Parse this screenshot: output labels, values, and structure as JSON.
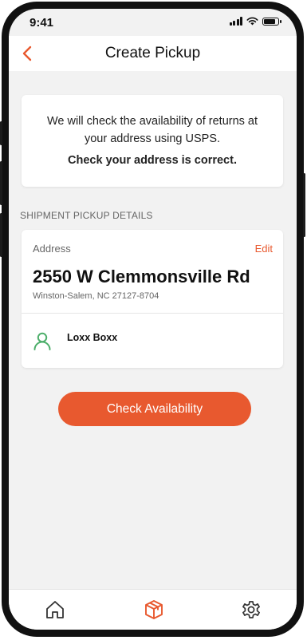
{
  "status_bar": {
    "time": "9:41"
  },
  "header": {
    "title": "Create Pickup"
  },
  "info": {
    "message": "We will check the availability of returns at your address using USPS.",
    "confirm": "Check your address is correct."
  },
  "details": {
    "section_label": "SHIPMENT PICKUP DETAILS",
    "address_label": "Address",
    "edit_label": "Edit",
    "street": "2550 W Clemmonsville Rd",
    "city_line": "Winston-Salem, NC 27127-8704",
    "contact_name": "Loxx Boxx"
  },
  "primary_button": {
    "label": "Check Availability"
  },
  "tab_bar": {
    "items": [
      {
        "icon": "home-icon",
        "active": false
      },
      {
        "icon": "box-icon",
        "active": true
      },
      {
        "icon": "gear-icon",
        "active": false
      }
    ]
  },
  "colors": {
    "accent": "#e8592f",
    "contact_icon": "#4cae6a",
    "background": "#f2f2f2",
    "card": "#ffffff",
    "text": "#111111",
    "muted": "#666666"
  }
}
